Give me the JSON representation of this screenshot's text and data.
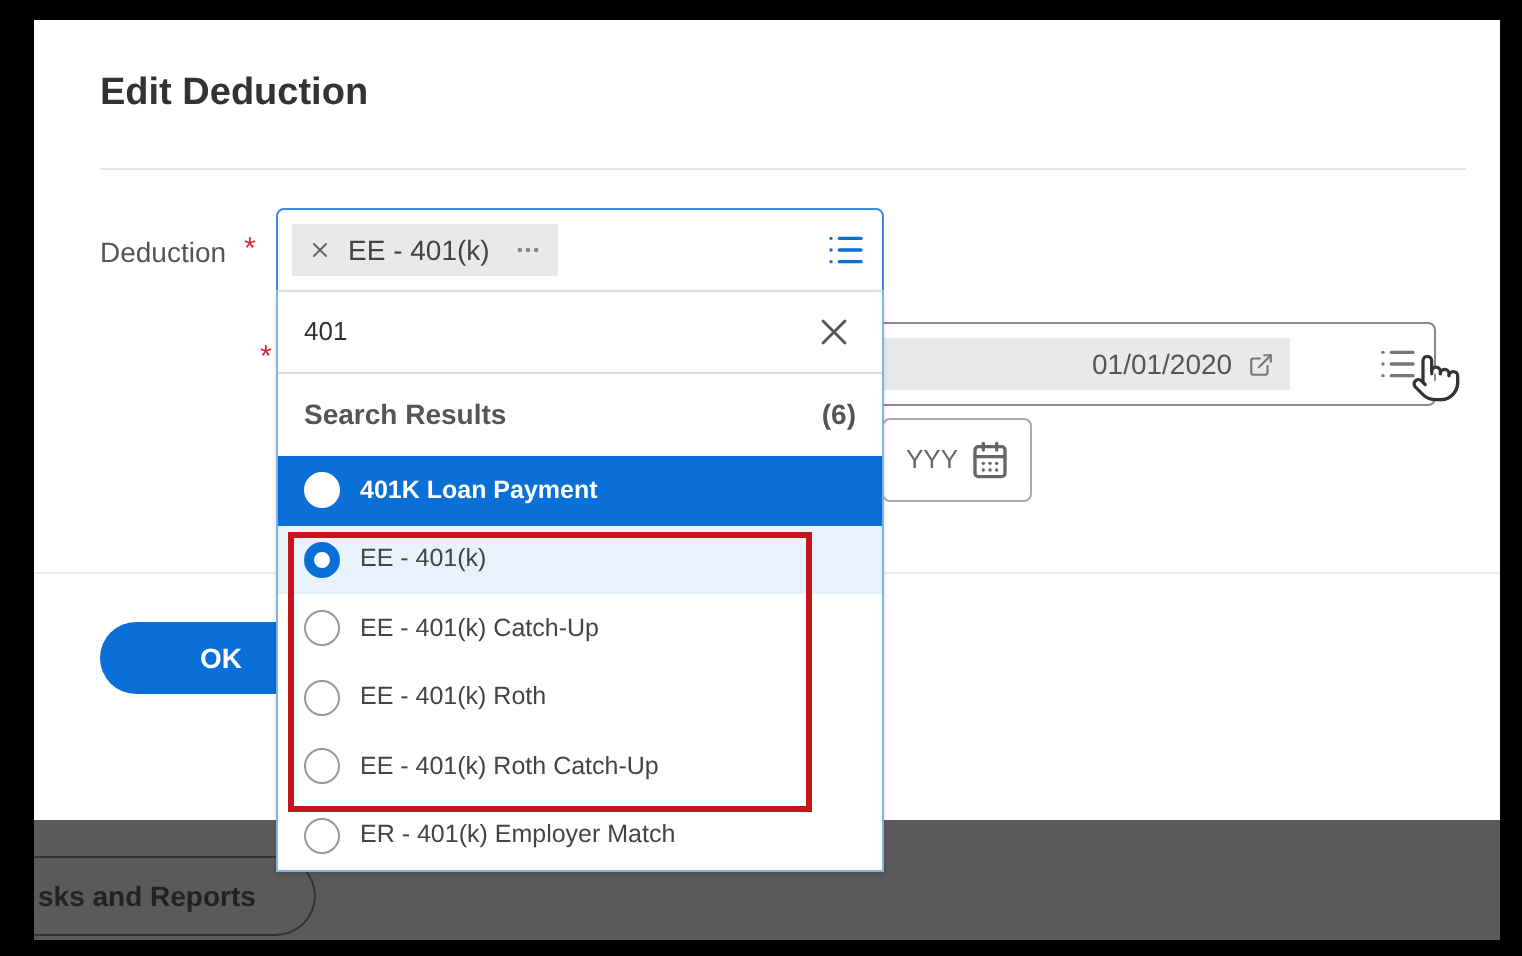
{
  "dialog": {
    "title": "Edit Deduction"
  },
  "deduction_field": {
    "label": "Deduction",
    "required_mark": "*",
    "chip": "EE - 401(k)",
    "search_value": "401"
  },
  "search_results": {
    "title": "Search Results",
    "count": "(6)",
    "items": [
      {
        "label": "401K Loan Payment",
        "selected": false,
        "hovered": true
      },
      {
        "label": "EE - 401(k)",
        "selected": true,
        "hovered": false
      },
      {
        "label": "EE - 401(k) Catch-Up",
        "selected": false,
        "hovered": false
      },
      {
        "label": "EE - 401(k) Roth",
        "selected": false,
        "hovered": false
      },
      {
        "label": "EE - 401(k) Roth Catch-Up",
        "selected": false,
        "hovered": false
      },
      {
        "label": "ER - 401(k) Employer Match",
        "selected": false,
        "hovered": false
      }
    ]
  },
  "date_field": {
    "required_mark": "*",
    "chip": "01/01/2020"
  },
  "date_input": {
    "placeholder": "YYY"
  },
  "buttons": [
    {
      "label": "OK"
    }
  ],
  "taskbar": {
    "button": "sks and Reports"
  }
}
